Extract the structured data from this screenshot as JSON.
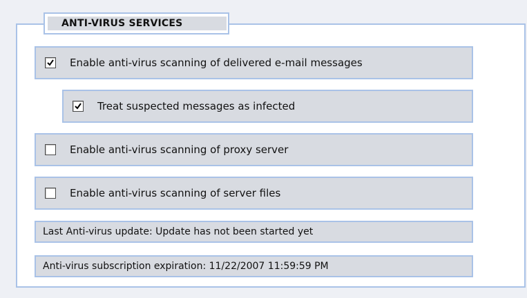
{
  "section": {
    "title": "ANTI-VIRUS SERVICES"
  },
  "options": [
    {
      "label": "Enable anti-virus scanning of delivered e-mail messages",
      "checked": true
    },
    {
      "label": "Treat suspected messages as infected",
      "checked": true
    },
    {
      "label": "Enable anti-virus scanning of proxy server",
      "checked": false
    },
    {
      "label": "Enable anti-virus scanning of server files",
      "checked": false
    }
  ],
  "status": {
    "last_update": "Last Anti-virus update: Update has not been started yet",
    "expiration": "Anti-virus subscription expiration: 11/22/2007 11:59:59 PM"
  },
  "colors": {
    "border": "#a9c2e7",
    "row_background": "#d8dbe1",
    "page_background": "#eef0f5"
  },
  "icons": {
    "checkbox_checked": "check-mark-icon"
  }
}
